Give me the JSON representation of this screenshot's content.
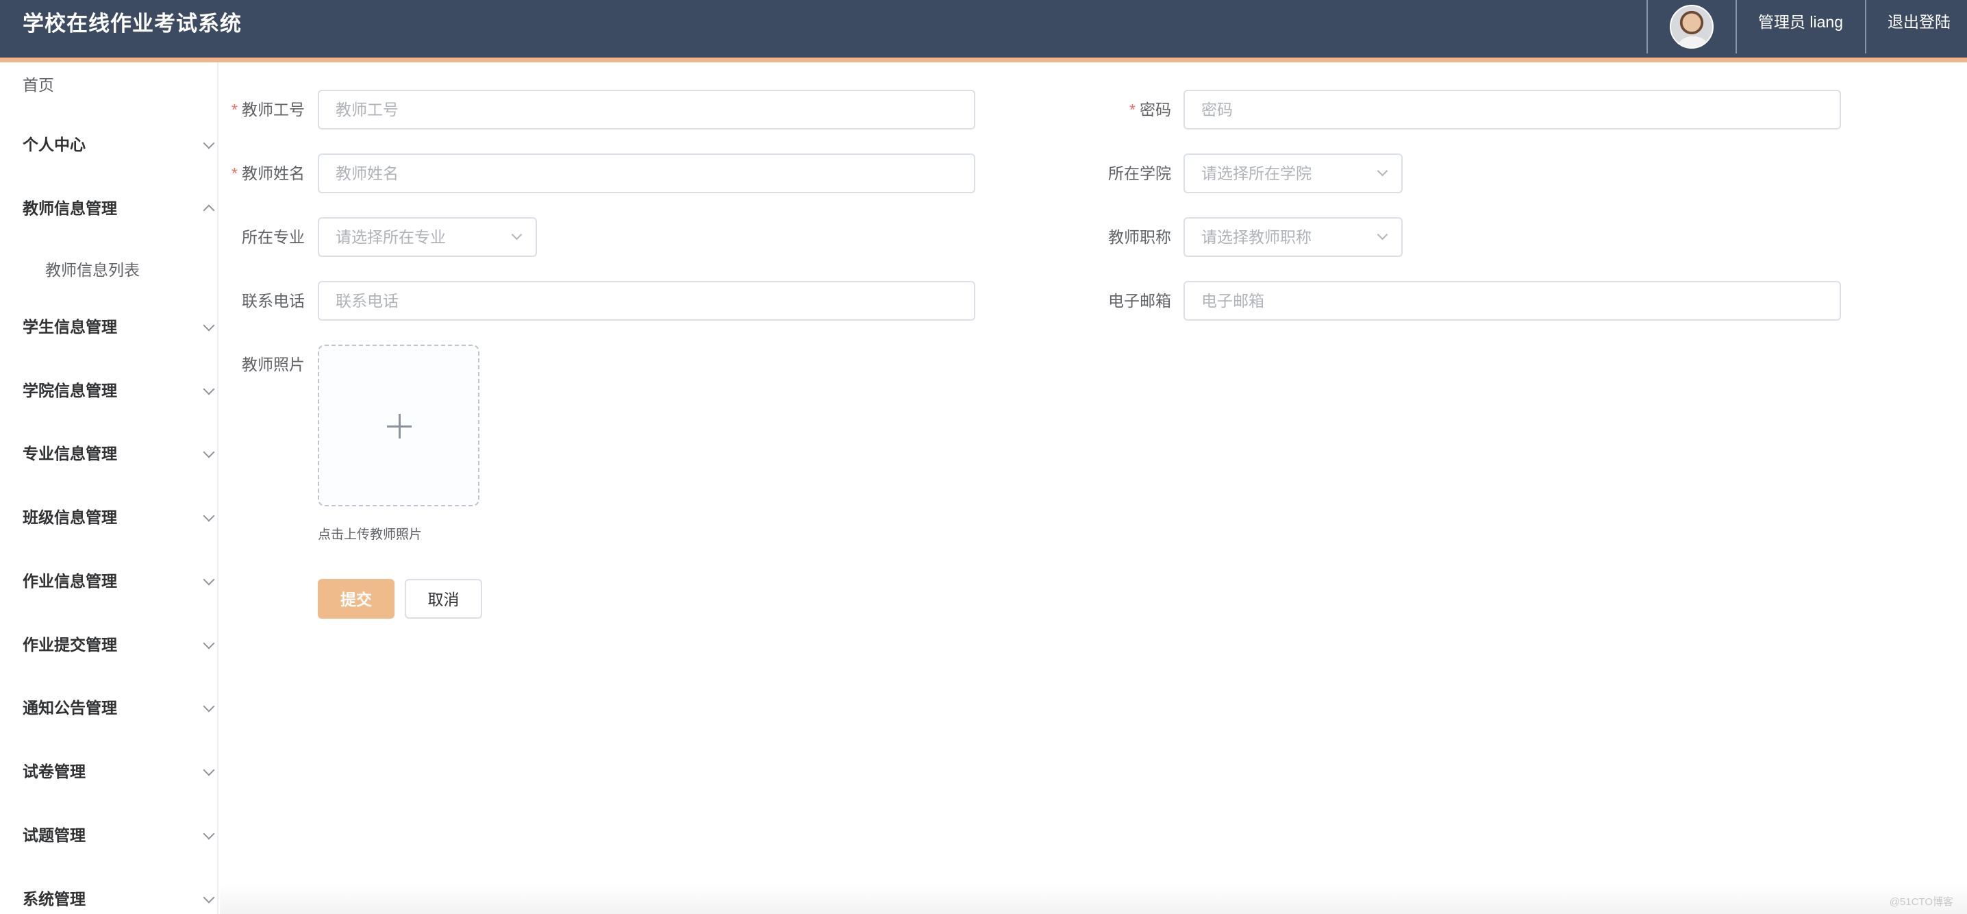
{
  "header": {
    "title": "学校在线作业考试系统",
    "user_label": "管理员 liang",
    "logout_label": "退出登陆",
    "accent_color": "#f2b48a",
    "bg_color": "#3c4a62"
  },
  "sidebar": {
    "home": "首页",
    "items": [
      {
        "label": "个人中心",
        "expanded": false
      },
      {
        "label": "教师信息管理",
        "expanded": true,
        "children": [
          "教师信息列表"
        ]
      },
      {
        "label": "学生信息管理",
        "expanded": false
      },
      {
        "label": "学院信息管理",
        "expanded": false
      },
      {
        "label": "专业信息管理",
        "expanded": false
      },
      {
        "label": "班级信息管理",
        "expanded": false
      },
      {
        "label": "作业信息管理",
        "expanded": false
      },
      {
        "label": "作业提交管理",
        "expanded": false
      },
      {
        "label": "通知公告管理",
        "expanded": false
      },
      {
        "label": "试卷管理",
        "expanded": false
      },
      {
        "label": "试题管理",
        "expanded": false
      },
      {
        "label": "系统管理",
        "expanded": false
      }
    ]
  },
  "form": {
    "teacher_id": {
      "label": "教师工号",
      "placeholder": "教师工号",
      "value": "",
      "required": true
    },
    "password": {
      "label": "密码",
      "placeholder": "密码",
      "value": "",
      "required": true
    },
    "teacher_name": {
      "label": "教师姓名",
      "placeholder": "教师姓名",
      "value": "",
      "required": true
    },
    "college": {
      "label": "所在学院",
      "placeholder": "请选择所在学院",
      "value": ""
    },
    "major": {
      "label": "所在专业",
      "placeholder": "请选择所在专业",
      "value": ""
    },
    "title": {
      "label": "教师职称",
      "placeholder": "请选择教师职称",
      "value": ""
    },
    "phone": {
      "label": "联系电话",
      "placeholder": "联系电话",
      "value": ""
    },
    "email": {
      "label": "电子邮箱",
      "placeholder": "电子邮箱",
      "value": ""
    },
    "photo": {
      "label": "教师照片",
      "tip": "点击上传教师照片"
    },
    "required_mark": "*",
    "submit_label": "提交",
    "cancel_label": "取消"
  },
  "watermark": "@51CTO博客"
}
